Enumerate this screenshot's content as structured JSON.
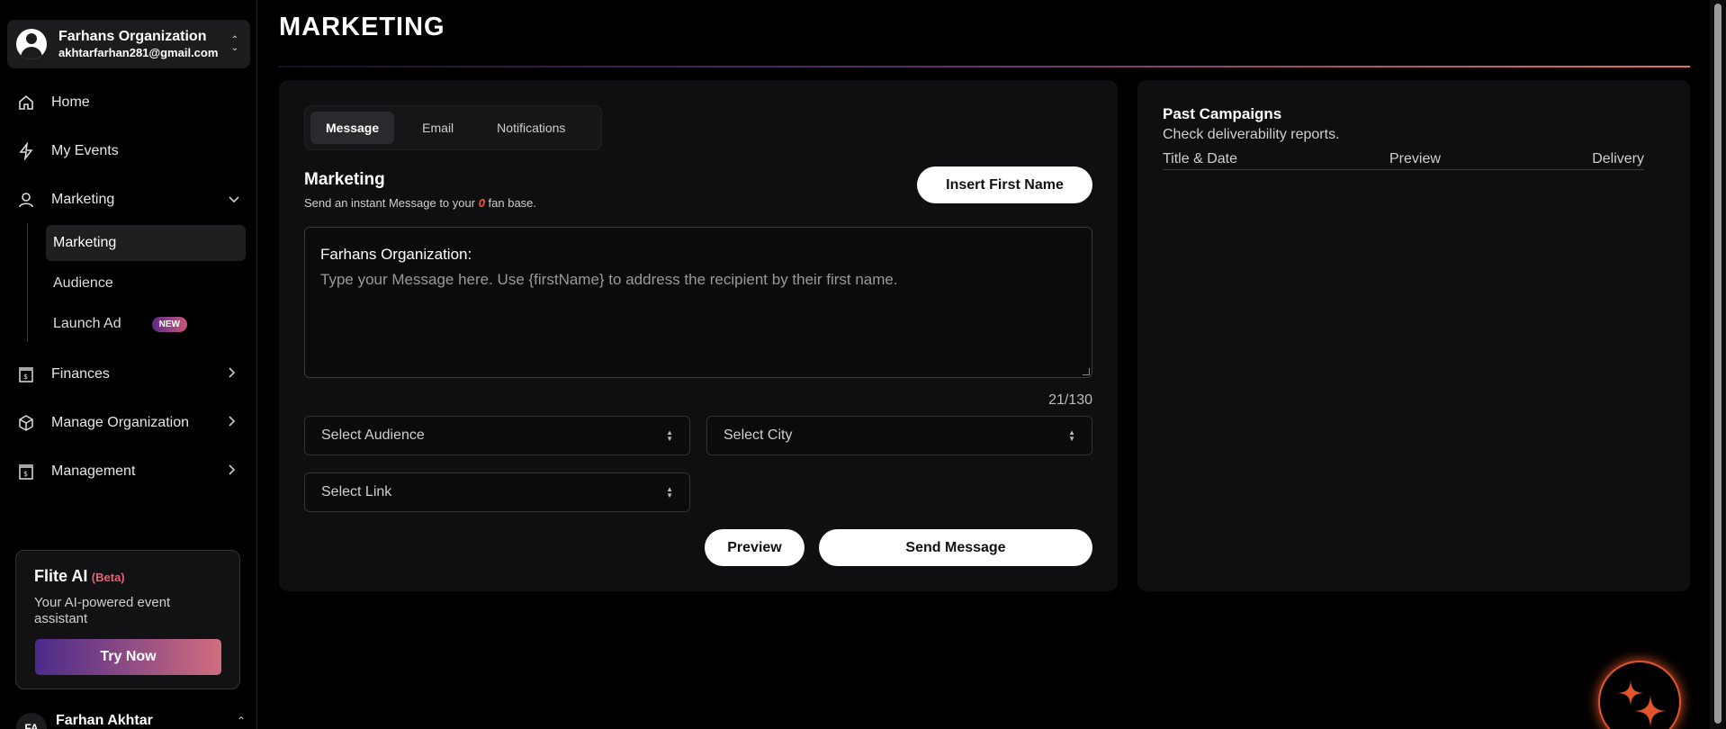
{
  "org": {
    "name": "Farhans Organization",
    "email": "akhtarfarhan281@gmail.com",
    "switch_icon": "chevron-up-down-icon"
  },
  "sidebar": {
    "items": [
      {
        "label": "Home",
        "icon": "home-icon"
      },
      {
        "label": "My Events",
        "icon": "lightning-icon"
      },
      {
        "label": "Marketing",
        "icon": "user-icon",
        "expanded": true
      },
      {
        "label": "Finances",
        "icon": "finance-icon"
      },
      {
        "label": "Manage Organization",
        "icon": "box-icon"
      },
      {
        "label": "Management",
        "icon": "finance-icon"
      }
    ],
    "sub_items": [
      {
        "label": "Marketing",
        "active": true
      },
      {
        "label": "Audience"
      },
      {
        "label": "Launch Ad",
        "badge": "NEW"
      }
    ]
  },
  "ai_card": {
    "title": "Flite AI",
    "beta": "(Beta)",
    "description": "Your AI-powered event assistant",
    "button": "Try Now"
  },
  "user": {
    "initials": "FA",
    "name": "Farhan Akhtar"
  },
  "page": {
    "title": "MARKETING"
  },
  "composer": {
    "tabs": [
      "Message",
      "Email",
      "Notifications"
    ],
    "active_tab": "Message",
    "section_title": "Marketing",
    "sub_prefix": "Send an instant Message to your ",
    "fan_count": "0",
    "sub_suffix": " fan base.",
    "insert_button": "Insert First Name",
    "message_prefix": "Farhans Organization:",
    "message_placeholder": "Type your Message here. Use {firstName} to address the recipient by their first name.",
    "counter": "21/130",
    "select_audience": "Select Audience",
    "select_city": "Select City",
    "select_link": "Select Link",
    "preview_button": "Preview",
    "send_button": "Send Message"
  },
  "past_campaigns": {
    "title": "Past Campaigns",
    "subtitle": "Check deliverability reports.",
    "columns": [
      "Title & Date",
      "Preview",
      "Delivery"
    ]
  },
  "colors": {
    "accent_orange": "#e2542b",
    "gradient_start": "#4a2a8a",
    "gradient_end": "#d26d7e",
    "beta_pink": "#e8607a",
    "zero_red": "#ff5533"
  },
  "fab": {
    "icon": "sparkle-icon"
  }
}
